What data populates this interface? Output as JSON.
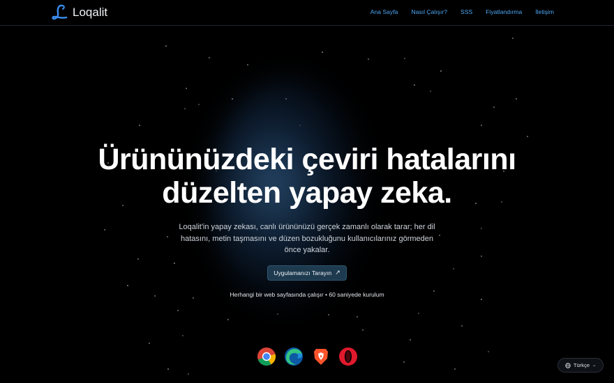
{
  "brand": {
    "name": "Loqalit",
    "logo_icon": "script-l-logo",
    "logo_color": "#3b8ef0"
  },
  "nav": {
    "items": [
      {
        "label": "Ana Sayfa"
      },
      {
        "label": "Nasıl Çalışır?"
      },
      {
        "label": "SSS"
      },
      {
        "label": "Fiyatlandırma"
      },
      {
        "label": "İletişim"
      }
    ]
  },
  "hero": {
    "headline_line1": "Ürününüzdeki çeviri hatalarını",
    "headline_line2": "düzelten yapay zeka.",
    "description": "Loqalit'in yapay zekası, canlı ürününüzü gerçek zamanlı olarak tarar; her dil hatasını, metin taşmasını ve düzen bozukluğunu kullanıcılarınız görmeden önce yakalar.",
    "cta_label": "Uygulamanızı Tarayın",
    "cta_icon": "arrow-up-right-icon",
    "subnote": "Herhangi bir web sayfasında çalışır • 60 saniyede kurulum"
  },
  "browsers": [
    "chrome-icon",
    "edge-icon",
    "brave-icon",
    "opera-icon"
  ],
  "language_selector": {
    "label": "Türkçe",
    "icon": "globe-icon"
  },
  "colors": {
    "background": "#000000",
    "accent": "#4ea7f5",
    "cta_bg": "#1e3a4f"
  }
}
